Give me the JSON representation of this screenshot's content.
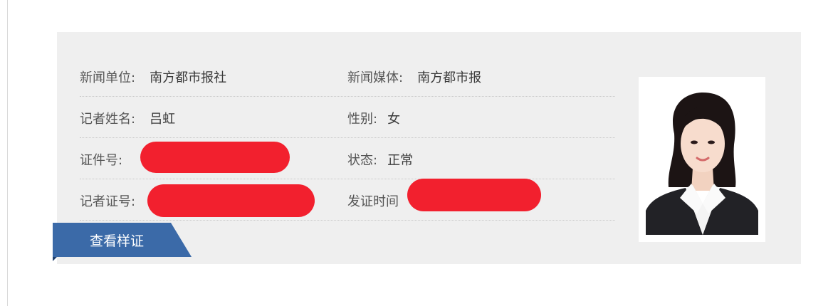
{
  "record": {
    "left_col": [
      {
        "label": "新闻单位:",
        "value": "南方都市报社"
      },
      {
        "label": "记者姓名:",
        "value": "吕虹"
      },
      {
        "label": "证件号:",
        "value": ""
      },
      {
        "label": "记者证号:",
        "value": ""
      }
    ],
    "right_col": [
      {
        "label": "新闻媒体:",
        "value": "南方都市报"
      },
      {
        "label": "性别:",
        "value": "女"
      },
      {
        "label": "状态:",
        "value": "正常"
      },
      {
        "label": "发证时间",
        "value": ""
      }
    ]
  },
  "actions": {
    "view_sample": "查看样证"
  },
  "colors": {
    "redaction": "#f2202e",
    "tab": "#3b6aa8",
    "card_bg": "#efefef"
  }
}
